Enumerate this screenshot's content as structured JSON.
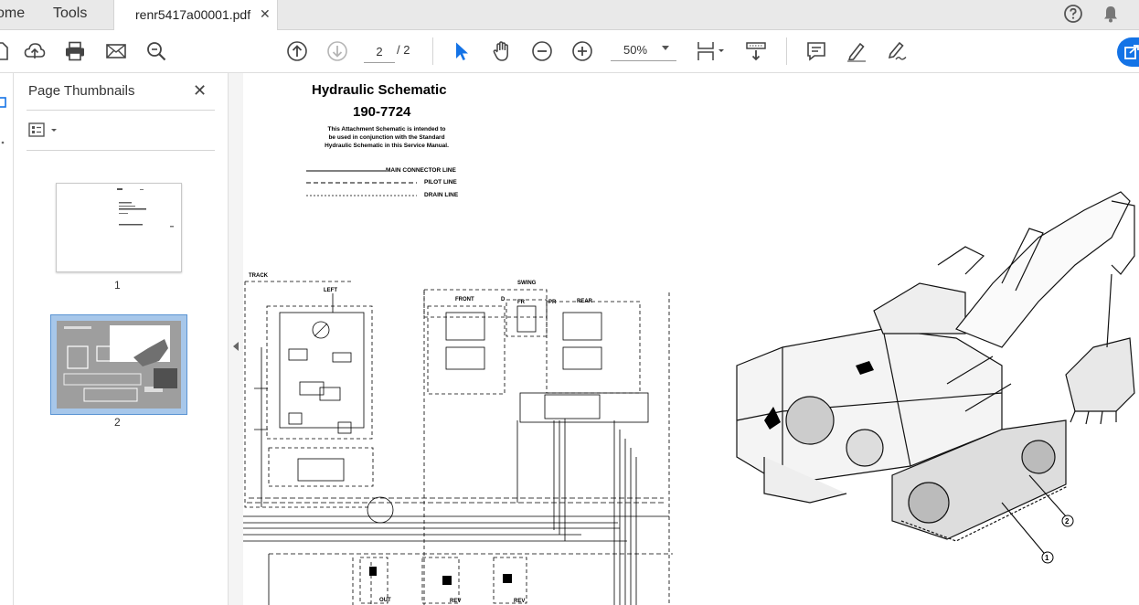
{
  "tabs": {
    "home_label": "ome",
    "tools_label": "Tools",
    "document_label": "renr5417a00001.pdf",
    "close_glyph": "✕"
  },
  "header_icons": [
    "help-icon",
    "bell-icon"
  ],
  "toolbar": {
    "icons": [
      "new-file-icon",
      "upload-icon",
      "print-icon",
      "email-icon",
      "search-zoom-icon",
      "prev-page-icon",
      "next-page-icon",
      "select-cursor-icon",
      "hand-icon",
      "zoom-out-icon",
      "zoom-in-icon",
      "page-fit-icon",
      "scroll-mode-icon",
      "comment-icon",
      "highlight-pen-icon",
      "sign-icon"
    ],
    "current_page": "2",
    "page_total": "/ 2",
    "zoom_value": "50%",
    "accent_color": "#1473e6"
  },
  "thumbnails_panel": {
    "title": "Page Thumbnails",
    "close_glyph": "✕",
    "pages": [
      {
        "number": "1"
      },
      {
        "number": "2"
      }
    ],
    "selected_page": "2",
    "selection_color": "#a7c7ea"
  },
  "document": {
    "title": "Hydraulic Schematic",
    "part_number": "190-7724",
    "note_lines": [
      "This Attachment Schematic is intended to",
      "be used in conjunction with the Standard",
      "Hydraulic Schematic in this Service Manual."
    ],
    "legend": {
      "main": "MAIN CONNECTOR LINE",
      "pilot": "PILOT LINE",
      "drain": "DRAIN LINE"
    },
    "labels": {
      "track": "TRACK",
      "left": "LEFT",
      "swing": "SWING",
      "front": "FRONT",
      "rear": "REAR",
      "fr": "FR",
      "pr": "PR",
      "d": "D",
      "out": "OUT",
      "rev": "REV",
      "rev2": "REV"
    },
    "callouts": [
      "1",
      "2"
    ]
  }
}
